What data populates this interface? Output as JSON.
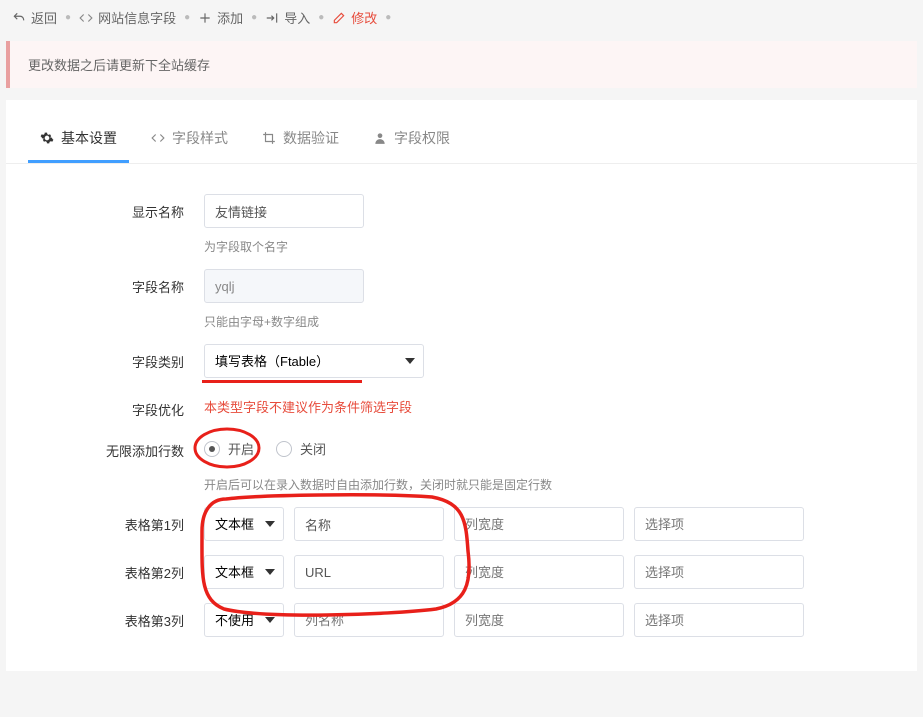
{
  "toolbar": {
    "back": "返回",
    "site_fields": "网站信息字段",
    "add": "添加",
    "import": "导入",
    "edit": "修改"
  },
  "alert": "更改数据之后请更新下全站缓存",
  "tabs": [
    {
      "label": "基本设置"
    },
    {
      "label": "字段样式"
    },
    {
      "label": "数据验证"
    },
    {
      "label": "字段权限"
    }
  ],
  "form": {
    "display_name": {
      "label": "显示名称",
      "value": "友情链接",
      "hint": "为字段取个名字"
    },
    "field_name": {
      "label": "字段名称",
      "value": "yqlj",
      "hint": "只能由字母+数字组成"
    },
    "field_type": {
      "label": "字段类别",
      "value": "填写表格（Ftable）"
    },
    "optimize": {
      "label": "字段优化",
      "text": "本类型字段不建议作为条件筛选字段"
    },
    "unlimited_rows": {
      "label": "无限添加行数",
      "on": "开启",
      "off": "关闭",
      "hint": "开启后可以在录入数据时自由添加行数，关闭时就只能是固定行数"
    },
    "cols": {
      "placeholder_name": "列名称",
      "placeholder_width": "列宽度",
      "placeholder_opt": "选择项",
      "r1": {
        "label": "表格第1列",
        "type": "文本框",
        "name": "名称"
      },
      "r2": {
        "label": "表格第2列",
        "type": "文本框",
        "name": "URL"
      },
      "r3": {
        "label": "表格第3列",
        "type": "不使用",
        "name": ""
      }
    }
  }
}
